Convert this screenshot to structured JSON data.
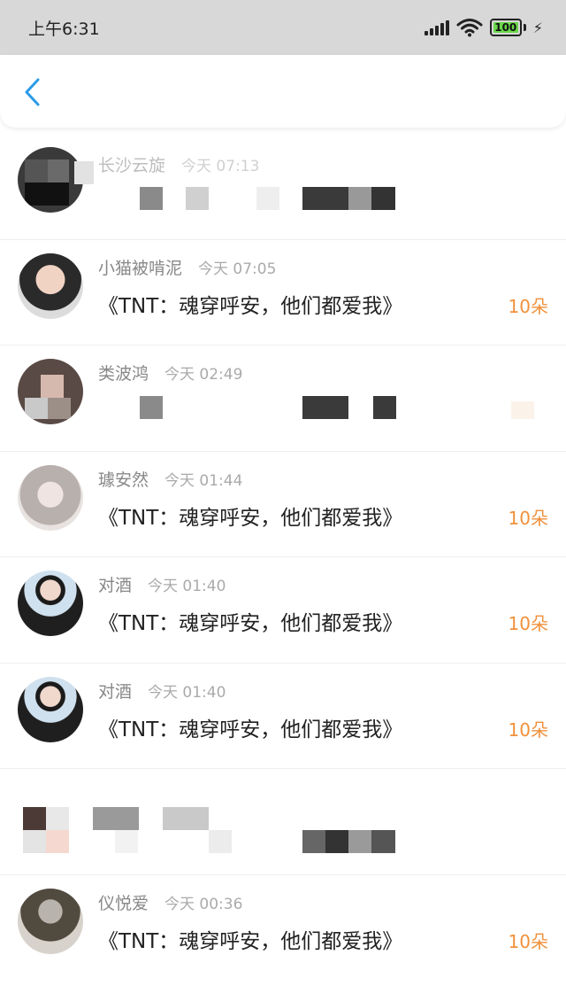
{
  "status_bar": {
    "time": "上午6:31",
    "battery": "100",
    "bolt_glyph": "⚡"
  },
  "header": {
    "back_icon": "chevron-left-icon",
    "accent": "#2a9be8"
  },
  "colors": {
    "count": "#f0913c",
    "username": "#888888",
    "time": "#aaaaaa"
  },
  "items": [
    {
      "username": "长沙云旋",
      "time": "今天 07:13",
      "message": "",
      "count": "",
      "obscured": true
    },
    {
      "username": "小猫被啃泥",
      "time": "今天 07:05",
      "message": "《TNT：魂穿呼安，他们都爱我》",
      "count": "10朵"
    },
    {
      "username": "类波鸿",
      "time": "今天 02:49",
      "message": "",
      "count": "",
      "obscured": true
    },
    {
      "username": "璩安然",
      "time": "今天 01:44",
      "message": "《TNT：魂穿呼安，他们都爱我》",
      "count": "10朵"
    },
    {
      "username": "对酒",
      "time": "今天 01:40",
      "message": "《TNT：魂穿呼安，他们都爱我》",
      "count": "10朵"
    },
    {
      "username": "对酒",
      "time": "今天 01:40",
      "message": "《TNT：魂穿呼安，他们都爱我》",
      "count": "10朵"
    },
    {
      "username": "",
      "time": "",
      "message": "",
      "count": "",
      "obscured": true
    },
    {
      "username": "仪悦爱",
      "time": "今天 00:36",
      "message": "《TNT：魂穿呼安，他们都爱我》",
      "count": "10朵"
    }
  ]
}
